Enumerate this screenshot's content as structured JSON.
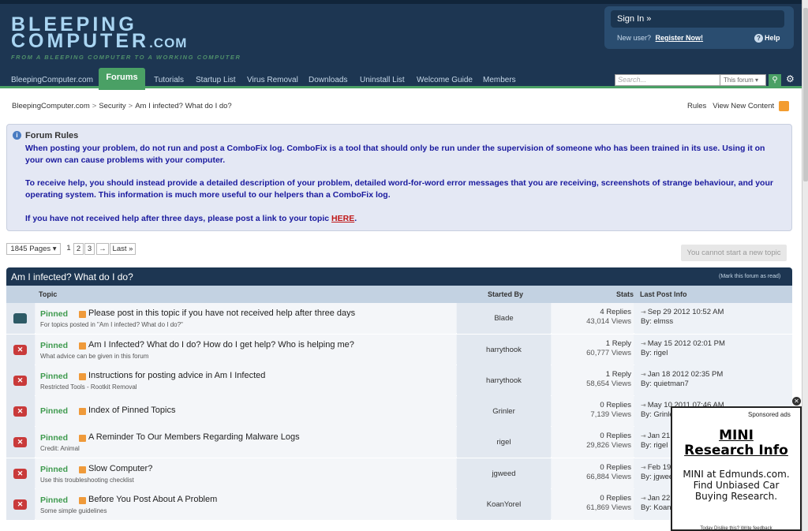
{
  "header": {
    "logo_line1": "BLEEPING",
    "logo_line2": "COMPUTER",
    "logo_dotcom": ".COM",
    "tagline": "FROM A BLEEPING COMPUTER TO A WORKING COMPUTER",
    "sign_in": "Sign In »",
    "new_user": "New user?",
    "register": "Register Now!",
    "help": "Help"
  },
  "nav": {
    "items": [
      "BleepingComputer.com",
      "Forums",
      "Tutorials",
      "Startup List",
      "Virus Removal",
      "Downloads",
      "Uninstall List",
      "Welcome Guide",
      "Members"
    ],
    "search_placeholder": "Search...",
    "search_scope": "This forum",
    "colors": {
      "header_bg": "#1d3652",
      "active_tab": "#4aa065"
    }
  },
  "breadcrumb": [
    "BleepingComputer.com",
    "Security",
    "Am I infected? What do I do?"
  ],
  "toplinks": {
    "rules": "Rules",
    "view_new": "View New Content"
  },
  "rules": {
    "title": "Forum Rules",
    "p1": "When posting your problem, do not run and post a ComboFix log. ComboFix is a tool that should only be run under the supervision of someone who has been trained in its use. Using it on your own can cause problems with your computer.",
    "p2": "To receive help, you should instead provide a detailed description of your problem, detailed word-for-word error messages that you are receiving, screenshots of strange behaviour, and your operating system. This information is much more useful to our helpers than a ComboFix log.",
    "p3": "If you have not received help after three days, please post a link to your topic",
    "here": "HERE",
    "period": "."
  },
  "pager": {
    "pages": "1845 Pages",
    "p1": "1",
    "p2": "2",
    "p3": "3",
    "next": "→",
    "last": "Last »"
  },
  "cannot_start": "You cannot start a new topic",
  "forum": {
    "title": "Am I infected? What do I do?",
    "mark_read": "(Mark this forum as read)",
    "cols": {
      "topic": "Topic",
      "started_by": "Started By",
      "stats": "Stats",
      "last_post": "Last Post Info"
    }
  },
  "topics": [
    {
      "pinned": "Pinned",
      "title": "Please post in this topic if you have not received help after three days",
      "desc": "For topics posted in \"Am I infected? What do I do?\"",
      "starter": "Blade",
      "replies": "4 Replies",
      "views": "43,014 Views",
      "last_date": "Sep 29 2012 10:52 AM",
      "last_by": "By: elmss",
      "icon": "folder"
    },
    {
      "pinned": "Pinned",
      "title": "Am I Infected? What do I do? How do I get help? Who is helping me?",
      "desc": "What advice can be given in this forum",
      "starter": "harrythook",
      "replies": "1 Reply",
      "views": "60,777 Views",
      "last_date": "May 15 2012 02:01 PM",
      "last_by": "By: rigel",
      "icon": "closed"
    },
    {
      "pinned": "Pinned",
      "title": "Instructions for posting advice in Am I Infected",
      "desc": "Restricted Tools - Rootkit Removal",
      "starter": "harrythook",
      "replies": "1 Reply",
      "views": "58,654 Views",
      "last_date": "Jan 18 2012 02:35 PM",
      "last_by": "By: quietman7",
      "icon": "closed"
    },
    {
      "pinned": "Pinned",
      "title": "Index of Pinned Topics",
      "desc": "",
      "starter": "Grinler",
      "replies": "0 Replies",
      "views": "7,139 Views",
      "last_date": "May 10 2011 07:46 AM",
      "last_by": "By: Grinler",
      "icon": "closed"
    },
    {
      "pinned": "Pinned",
      "title": "A Reminder To Our Members Regarding Malware Logs",
      "desc": "Credit: Animal",
      "starter": "rigel",
      "replies": "0 Replies",
      "views": "29,826 Views",
      "last_date": "Jan 21",
      "last_by": "By: rigel",
      "icon": "closed"
    },
    {
      "pinned": "Pinned",
      "title": "Slow Computer?",
      "desc": "Use this troubleshooting checklist",
      "starter": "jgweed",
      "replies": "0 Replies",
      "views": "66,884 Views",
      "last_date": "Feb 19",
      "last_by": "By: jgweed",
      "icon": "closed"
    },
    {
      "pinned": "Pinned",
      "title": "Before You Post About A Problem",
      "desc": "Some simple guidelines",
      "starter": "KoanYorel",
      "replies": "0 Replies",
      "views": "61,869 Views",
      "last_date": "Jan 22",
      "last_by": "By: KoanYorel",
      "icon": "closed"
    }
  ],
  "ad": {
    "sponsored": "Sponsored ads",
    "headline_1": "MINI",
    "headline_2": "Research Info",
    "body_1": "MINI at Edmunds.com.",
    "body_2": "Find Unbiased Car",
    "body_3": "Buying Research.",
    "footer": "Today   Dislike this? Write feedback"
  }
}
